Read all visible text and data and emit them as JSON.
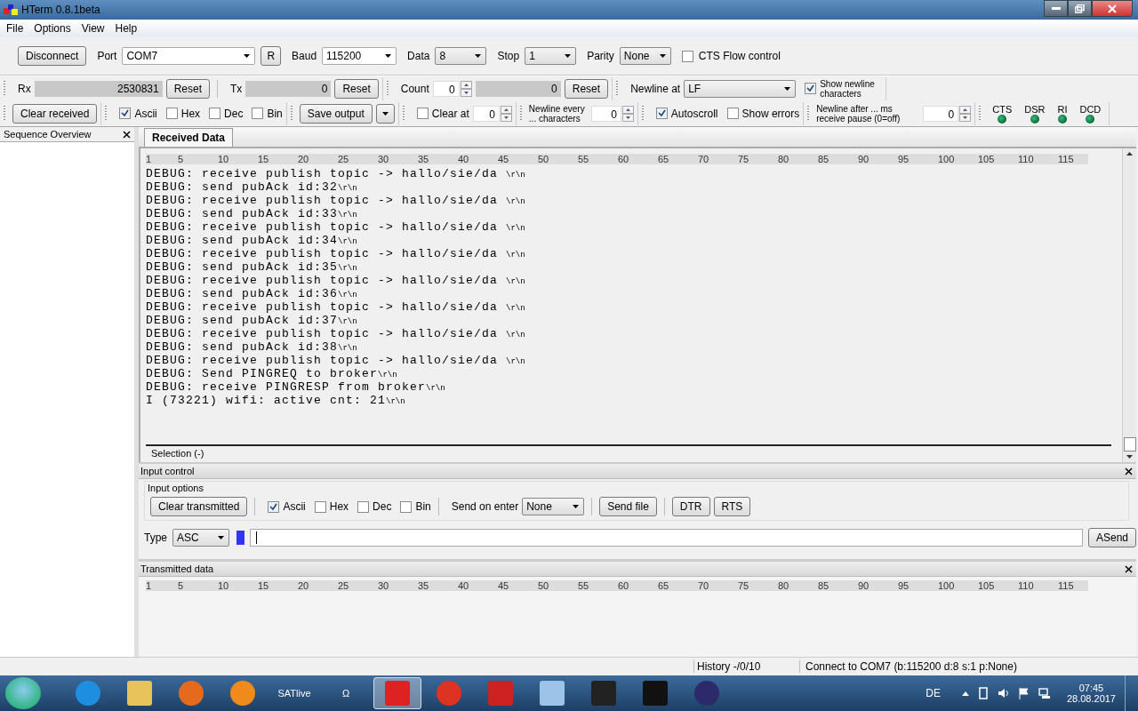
{
  "window": {
    "title": "HTerm 0.8.1beta"
  },
  "menu": [
    "File",
    "Options",
    "View",
    "Help"
  ],
  "connection": {
    "connect_button": "Disconnect",
    "port_label": "Port",
    "port": "COM7",
    "refresh_button": "R",
    "baud_label": "Baud",
    "baud": "115200",
    "data_label": "Data",
    "data": "8",
    "stop_label": "Stop",
    "stop": "1",
    "parity_label": "Parity",
    "parity": "None",
    "cts_flow": {
      "label": "CTS Flow control",
      "checked": false
    }
  },
  "counters": {
    "rx_label": "Rx",
    "rx_value": "2530831",
    "rx_reset": "Reset",
    "tx_label": "Tx",
    "tx_value": "0",
    "tx_reset": "Reset",
    "count_label": "Count",
    "count_value": "0",
    "count_total": "0",
    "count_reset": "Reset",
    "newline_label": "Newline at",
    "newline_value": "LF",
    "show_newline": {
      "label": "Show newline characters",
      "checked": true
    }
  },
  "display": {
    "clear_button": "Clear received",
    "formats": [
      {
        "label": "Ascii",
        "checked": true
      },
      {
        "label": "Hex",
        "checked": false
      },
      {
        "label": "Dec",
        "checked": false
      },
      {
        "label": "Bin",
        "checked": false
      }
    ],
    "save_button": "Save output",
    "clear_at": {
      "label": "Clear at",
      "checked": false,
      "value": "0"
    },
    "newline_every_label": "Newline every ... characters",
    "newline_every_value": "0",
    "autoscroll": {
      "label": "Autoscroll",
      "checked": true
    },
    "show_errors": {
      "label": "Show errors",
      "checked": false
    },
    "newline_after_label": "Newline after ... ms receive pause (0=off)",
    "newline_after_value": "0"
  },
  "signals": [
    {
      "label": "CTS",
      "on": false
    },
    {
      "label": "DSR",
      "on": false
    },
    {
      "label": "RI",
      "on": false
    },
    {
      "label": "DCD",
      "on": false
    }
  ],
  "sequence_overview": {
    "title": "Sequence Overview"
  },
  "received": {
    "tab": "Received Data",
    "ruler": [
      "1",
      "5",
      "10",
      "15",
      "20",
      "25",
      "30",
      "35",
      "40",
      "45",
      "50",
      "55",
      "60",
      "65",
      "70",
      "75",
      "80",
      "85",
      "90",
      "95",
      "100",
      "105",
      "110",
      "115"
    ],
    "lines": [
      {
        "text": "DEBUG: receive publish topic -> hallo/sie/da ",
        "eol": "\\r\\n"
      },
      {
        "text": "DEBUG: send pubAck id:32",
        "eol": "\\r\\n"
      },
      {
        "text": "DEBUG: receive publish topic -> hallo/sie/da ",
        "eol": "\\r\\n"
      },
      {
        "text": "DEBUG: send pubAck id:33",
        "eol": "\\r\\n"
      },
      {
        "text": "DEBUG: receive publish topic -> hallo/sie/da ",
        "eol": "\\r\\n"
      },
      {
        "text": "DEBUG: send pubAck id:34",
        "eol": "\\r\\n"
      },
      {
        "text": "DEBUG: receive publish topic -> hallo/sie/da ",
        "eol": "\\r\\n"
      },
      {
        "text": "DEBUG: send pubAck id:35",
        "eol": "\\r\\n"
      },
      {
        "text": "DEBUG: receive publish topic -> hallo/sie/da ",
        "eol": "\\r\\n"
      },
      {
        "text": "DEBUG: send pubAck id:36",
        "eol": "\\r\\n"
      },
      {
        "text": "DEBUG: receive publish topic -> hallo/sie/da ",
        "eol": "\\r\\n"
      },
      {
        "text": "DEBUG: send pubAck id:37",
        "eol": "\\r\\n"
      },
      {
        "text": "DEBUG: receive publish topic -> hallo/sie/da ",
        "eol": "\\r\\n"
      },
      {
        "text": "DEBUG: send pubAck id:38",
        "eol": "\\r\\n"
      },
      {
        "text": "DEBUG: receive publish topic -> hallo/sie/da ",
        "eol": "\\r\\n"
      },
      {
        "text": "DEBUG: Send PINGREQ to broker",
        "eol": "\\r\\n"
      },
      {
        "text": "DEBUG: receive PINGRESP from broker",
        "eol": "\\r\\n"
      },
      {
        "text": "I (73221) wifi: active cnt: 21",
        "eol": "\\r\\n"
      }
    ],
    "selection": "Selection (-)"
  },
  "input_control": {
    "title": "Input control",
    "group": "Input options",
    "clear_button": "Clear transmitted",
    "formats": [
      {
        "label": "Ascii",
        "checked": true
      },
      {
        "label": "Hex",
        "checked": false
      },
      {
        "label": "Dec",
        "checked": false
      },
      {
        "label": "Bin",
        "checked": false
      }
    ],
    "send_on_enter_label": "Send on enter",
    "send_on_enter": "None",
    "send_file_button": "Send file",
    "dtr_button": "DTR",
    "rts_button": "RTS",
    "type_label": "Type",
    "type": "ASC",
    "send_button": "ASend"
  },
  "transmitted": {
    "title": "Transmitted data",
    "ruler": [
      "1",
      "5",
      "10",
      "15",
      "20",
      "25",
      "30",
      "35",
      "40",
      "45",
      "50",
      "55",
      "60",
      "65",
      "70",
      "75",
      "80",
      "85",
      "90",
      "95",
      "100",
      "105",
      "110",
      "115"
    ]
  },
  "status_bar": {
    "history": "History -/0/10",
    "connection": "Connect to COM7 (b:115200 d:8 s:1 p:None)"
  },
  "taskbar": {
    "items": [
      {
        "kind": "browser-e",
        "selected": false
      },
      {
        "kind": "folder",
        "selected": false
      },
      {
        "kind": "browser-fox",
        "selected": false
      },
      {
        "kind": "media",
        "selected": false
      },
      {
        "kind": "label",
        "label": "SATlive",
        "selected": false
      },
      {
        "kind": "label",
        "label": "Ω",
        "selected": false
      },
      {
        "kind": "squares",
        "selected": true
      },
      {
        "kind": "ring",
        "selected": false
      },
      {
        "kind": "logo",
        "selected": false
      },
      {
        "kind": "calculator",
        "selected": false
      },
      {
        "kind": "chip",
        "selected": false
      },
      {
        "kind": "console",
        "selected": false
      },
      {
        "kind": "eclipse",
        "selected": false
      }
    ],
    "language": "DE",
    "time": "07:45",
    "date": "28.08.2017"
  }
}
